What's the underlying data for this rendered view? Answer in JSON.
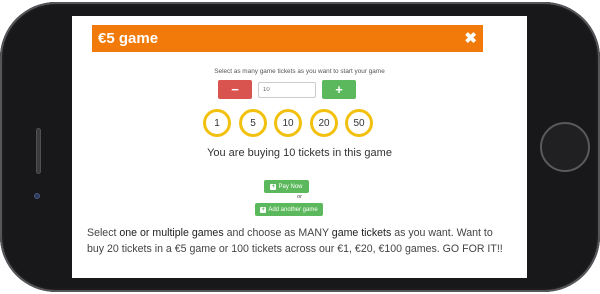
{
  "modal": {
    "title": "€5 game"
  },
  "instruction": "Select as many game tickets as you want to start your game",
  "stepper": {
    "minus": "−",
    "value": "10",
    "plus": "+"
  },
  "presets": [
    "1",
    "5",
    "10",
    "20",
    "50"
  ],
  "summary": "You are buying 10 tickets in this game",
  "buttons": {
    "pay_now": "Pay Now",
    "or": "or",
    "add_another": "Add another game"
  },
  "description": {
    "p1": "Select ",
    "h1": "one or multiple games",
    "p2": " and choose as MANY ",
    "h2": "game tickets",
    "p3": " as you want. Want to buy 20 tickets in a €5 game or 100 tickets across our €1, €20, €100 games. GO FOR IT!!"
  },
  "colors": {
    "header": "#f27a0b",
    "minus": "#d9534f",
    "plus": "#5cb85c",
    "preset_ring": "#f2c10f"
  }
}
